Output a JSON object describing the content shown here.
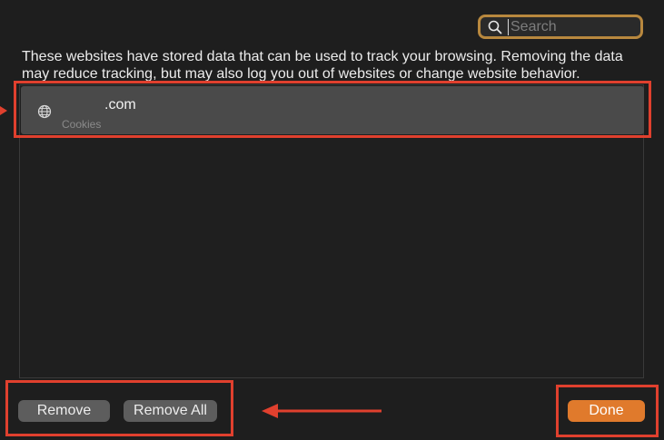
{
  "search": {
    "placeholder": "Search",
    "icon": "search-icon"
  },
  "description": "These websites have stored data that can be used to track your browsing. Removing the data may reduce tracking, but may also log you out of websites or change website behavior.",
  "websites": [
    {
      "icon": "globe-icon",
      "domain": ".com",
      "detail": "Cookies",
      "selected": true
    }
  ],
  "buttons": {
    "remove": "Remove",
    "remove_all": "Remove All",
    "done": "Done"
  },
  "colors": {
    "accent": "#e07a2c",
    "annotation": "#e0402e",
    "search_focus": "#b8883e",
    "selected_row": "#4a4a4a"
  }
}
